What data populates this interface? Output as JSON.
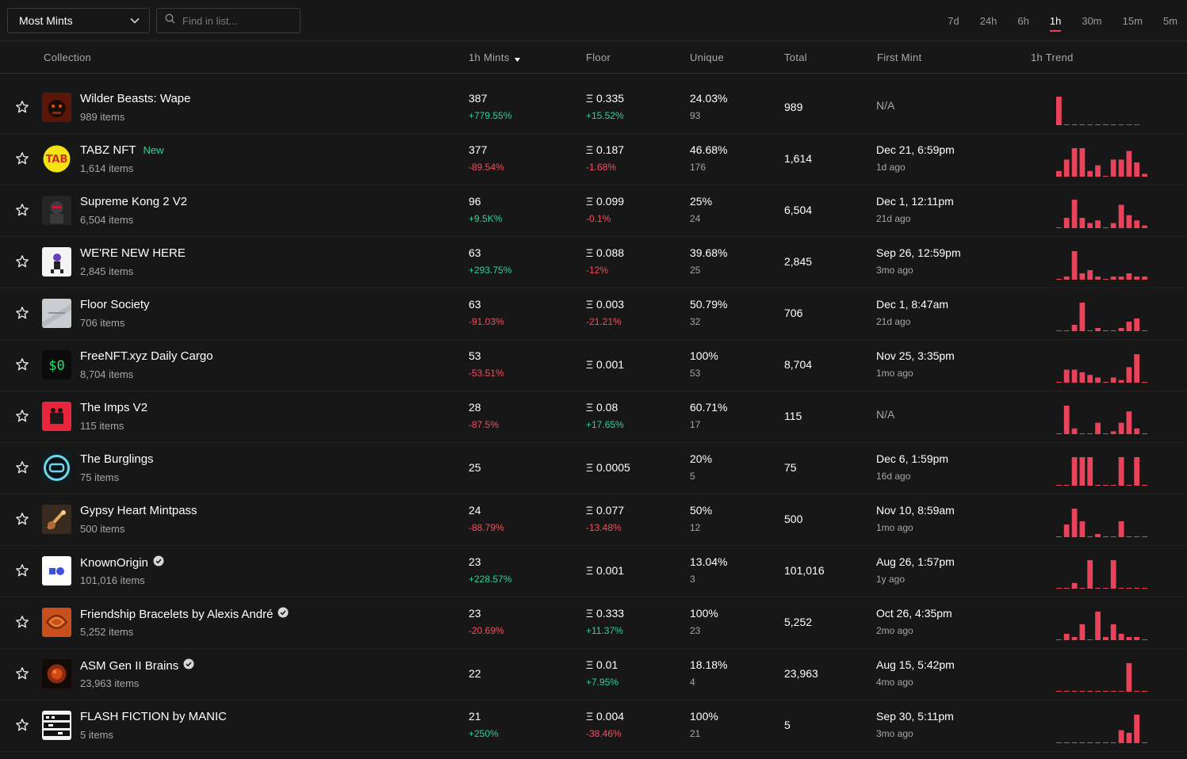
{
  "toolbar": {
    "sort_select": "Most Mints",
    "search_placeholder": "Find in list...",
    "time_tabs": [
      "7d",
      "24h",
      "6h",
      "1h",
      "30m",
      "15m",
      "5m"
    ],
    "active_tab": "1h"
  },
  "columns": {
    "collection": "Collection",
    "mints": "1h Mints",
    "floor": "Floor",
    "unique": "Unique",
    "total": "Total",
    "first_mint": "First Mint",
    "trend": "1h Trend"
  },
  "colors": {
    "accent": "#e8435a",
    "positive": "#2fd0a0",
    "negative": "#ef5060",
    "background": "#171717"
  },
  "rows": [
    {
      "name": "Wilder Beasts: Wape",
      "items": "989 items",
      "badge": "",
      "verified": false,
      "avatar_icon": "wape-avatar",
      "mints": "387",
      "mints_change": "+779.55%",
      "floor": "Ξ 0.335",
      "floor_change": "+15.52%",
      "unique_pct": "24.03%",
      "unique_count": "93",
      "total": "989",
      "first_mint": "N/A",
      "first_mint_ago": "",
      "trend": [
        10,
        0,
        0,
        0,
        0,
        0,
        0,
        0,
        0,
        0,
        0
      ]
    },
    {
      "name": "TABZ NFT",
      "items": "1,614 items",
      "badge": "New",
      "verified": false,
      "avatar_icon": "tabz-avatar",
      "mints": "377",
      "mints_change": "-89.54%",
      "floor": "Ξ 0.187",
      "floor_change": "-1.68%",
      "unique_pct": "46.68%",
      "unique_count": "176",
      "total": "1,614",
      "first_mint": "Dec 21, 6:59pm",
      "first_mint_ago": "1d ago",
      "trend": [
        2,
        6,
        10,
        10,
        2,
        4,
        0,
        6,
        6,
        9,
        5,
        1
      ]
    },
    {
      "name": "Supreme Kong 2 V2",
      "items": "6,504 items",
      "badge": "",
      "verified": false,
      "avatar_icon": "kong-avatar",
      "mints": "96",
      "mints_change": "+9.5K%",
      "floor": "Ξ 0.099",
      "floor_change": "-0.1%",
      "unique_pct": "25%",
      "unique_count": "24",
      "total": "6,504",
      "first_mint": "Dec 1, 12:11pm",
      "first_mint_ago": "21d ago",
      "trend": [
        0,
        4,
        11,
        4,
        2,
        3,
        0,
        2,
        9,
        5,
        3,
        1
      ]
    },
    {
      "name": "WE'RE NEW HERE",
      "items": "2,845 items",
      "badge": "",
      "verified": false,
      "avatar_icon": "werenewhere-avatar",
      "mints": "63",
      "mints_change": "+293.75%",
      "floor": "Ξ 0.088",
      "floor_change": "-12%",
      "unique_pct": "39.68%",
      "unique_count": "25",
      "total": "2,845",
      "first_mint": "Sep 26, 12:59pm",
      "first_mint_ago": "3mo ago",
      "trend": [
        0,
        1,
        9,
        2,
        3,
        1,
        0,
        1,
        1,
        2,
        1,
        1
      ]
    },
    {
      "name": "Floor Society",
      "items": "706 items",
      "badge": "",
      "verified": false,
      "avatar_icon": "floor-society-avatar",
      "mints": "63",
      "mints_change": "-91.03%",
      "floor": "Ξ 0.003",
      "floor_change": "-21.21%",
      "unique_pct": "50.79%",
      "unique_count": "32",
      "total": "706",
      "first_mint": "Dec 1, 8:47am",
      "first_mint_ago": "21d ago",
      "trend": [
        0,
        0,
        2,
        9,
        0,
        1,
        0,
        0,
        1,
        3,
        4,
        0
      ]
    },
    {
      "name": "FreeNFT.xyz Daily Cargo",
      "items": "8,704 items",
      "badge": "",
      "verified": false,
      "avatar_icon": "freenft-avatar",
      "mints": "53",
      "mints_change": "-53.51%",
      "floor": "Ξ 0.001",
      "floor_change": "",
      "unique_pct": "100%",
      "unique_count": "53",
      "total": "8,704",
      "first_mint": "Nov 25, 3:35pm",
      "first_mint_ago": "1mo ago",
      "trend": [
        0,
        5,
        5,
        4,
        3,
        2,
        0,
        2,
        1,
        6,
        11,
        0
      ]
    },
    {
      "name": "The Imps V2",
      "items": "115 items",
      "badge": "",
      "verified": false,
      "avatar_icon": "imps-avatar",
      "mints": "28",
      "mints_change": "-87.5%",
      "floor": "Ξ 0.08",
      "floor_change": "+17.65%",
      "unique_pct": "60.71%",
      "unique_count": "17",
      "total": "115",
      "first_mint": "N/A",
      "first_mint_ago": "",
      "trend": [
        0,
        10,
        2,
        0,
        0,
        4,
        0,
        1,
        4,
        8,
        2,
        0
      ]
    },
    {
      "name": "The Burglings",
      "items": "75 items",
      "badge": "",
      "verified": false,
      "avatar_icon": "burglings-avatar",
      "mints": "25",
      "mints_change": "",
      "floor": "Ξ 0.0005",
      "floor_change": "",
      "unique_pct": "20%",
      "unique_count": "5",
      "total": "75",
      "first_mint": "Dec 6, 1:59pm",
      "first_mint_ago": "16d ago",
      "trend": [
        0,
        0,
        10,
        10,
        10,
        0,
        0,
        0,
        10,
        0,
        10,
        0
      ]
    },
    {
      "name": "Gypsy Heart Mintpass",
      "items": "500 items",
      "badge": "",
      "verified": false,
      "avatar_icon": "gypsy-heart-avatar",
      "mints": "24",
      "mints_change": "-88.79%",
      "floor": "Ξ 0.077",
      "floor_change": "-13.48%",
      "unique_pct": "50%",
      "unique_count": "12",
      "total": "500",
      "first_mint": "Nov 10, 8:59am",
      "first_mint_ago": "1mo ago",
      "trend": [
        0,
        4,
        9,
        5,
        0,
        1,
        0,
        0,
        5,
        0,
        0,
        0
      ]
    },
    {
      "name": "KnownOrigin",
      "items": "101,016 items",
      "badge": "",
      "verified": true,
      "avatar_icon": "knownorigin-avatar",
      "mints": "23",
      "mints_change": "+228.57%",
      "floor": "Ξ 0.001",
      "floor_change": "",
      "unique_pct": "13.04%",
      "unique_count": "3",
      "total": "101,016",
      "first_mint": "Aug 26, 1:57pm",
      "first_mint_ago": "1y ago",
      "trend": [
        0,
        0,
        2,
        0,
        10,
        0,
        0,
        10,
        0,
        0,
        0,
        0
      ]
    },
    {
      "name": "Friendship Bracelets by Alexis André",
      "items": "5,252 items",
      "badge": "",
      "verified": true,
      "avatar_icon": "friendship-bracelets-avatar",
      "mints": "23",
      "mints_change": "-20.69%",
      "floor": "Ξ 0.333",
      "floor_change": "+11.37%",
      "unique_pct": "100%",
      "unique_count": "23",
      "total": "5,252",
      "first_mint": "Oct 26, 4:35pm",
      "first_mint_ago": "2mo ago",
      "trend": [
        0,
        2,
        1,
        5,
        0,
        9,
        1,
        5,
        2,
        1,
        1,
        0
      ]
    },
    {
      "name": "ASM Gen II Brains",
      "items": "23,963 items",
      "badge": "",
      "verified": true,
      "avatar_icon": "asm-brains-avatar",
      "mints": "22",
      "mints_change": "",
      "floor": "Ξ 0.01",
      "floor_change": "+7.95%",
      "unique_pct": "18.18%",
      "unique_count": "4",
      "total": "23,963",
      "first_mint": "Aug 15, 5:42pm",
      "first_mint_ago": "4mo ago",
      "trend": [
        0,
        0,
        0,
        0,
        0,
        0,
        0,
        0,
        0,
        10,
        0,
        0
      ]
    },
    {
      "name": "FLASH FICTION by MANIC",
      "items": "5 items",
      "badge": "",
      "verified": false,
      "avatar_icon": "flash-fiction-avatar",
      "mints": "21",
      "mints_change": "+250%",
      "floor": "Ξ 0.004",
      "floor_change": "-38.46%",
      "unique_pct": "100%",
      "unique_count": "21",
      "total": "5",
      "first_mint": "Sep 30, 5:11pm",
      "first_mint_ago": "3mo ago",
      "trend": [
        0,
        0,
        0,
        0,
        0,
        0,
        0,
        0,
        5,
        4,
        11,
        0
      ]
    }
  ]
}
